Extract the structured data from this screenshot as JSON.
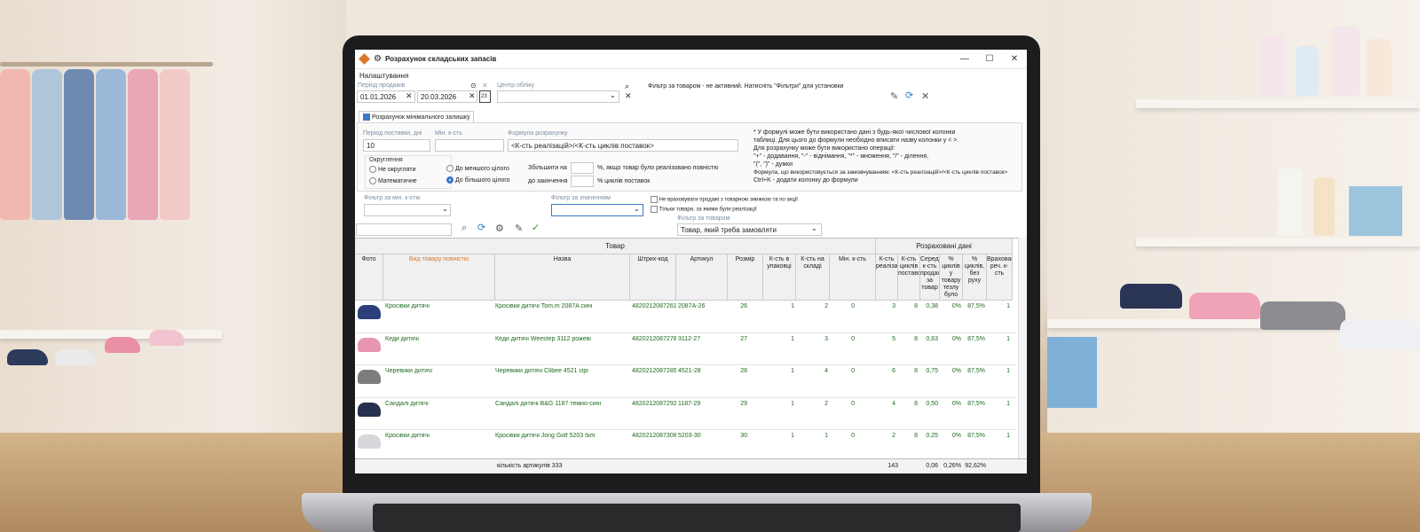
{
  "window": {
    "title": "Розрахунок складських запасів",
    "icon": "app-logo-icon",
    "controls": [
      "—",
      "☐",
      "✕"
    ]
  },
  "menu": {
    "settings": "Налаштування"
  },
  "period": {
    "label": "Період продажів",
    "from": "01.01.2026",
    "to": "20.03.2026",
    "calendar_label": "23"
  },
  "accounting_center": {
    "label": "Центр обліку",
    "value": ""
  },
  "product_filter_notice": "Фільтр за товаром - не активний. Натисніть \"Фільтри\" для установки",
  "min_balance_tab": {
    "checkbox_label": "Розрахунок мінімального залишку",
    "checked": true,
    "supply_period_label": "Період поставки, дні",
    "supply_period_value": "10",
    "min_qty_label": "Мін. к-сть",
    "min_qty_value": "",
    "formula_label": "Формула розрахунку",
    "formula_value": "<К-сть реалізацій>/<К-сть циклів поставок>",
    "rounding_label": "Округлення",
    "rounding_options": [
      "Не округляти",
      "Математичне",
      "До меншого цілого",
      "До більшого цілого"
    ],
    "rounding_selected": "До більшого цілого",
    "increase_label": "Збільшити на",
    "increase_suffix": "%, якщо товар було реалізовано повністю",
    "until_end_label": "до закінчення",
    "until_end_suffix": "% циклів поставок",
    "help_lines": [
      "* У формулі може бути використано дані з будь-якої числової колонки",
      "таблиці. Для цього до формули необхідно вписати назву колонки у < >.",
      "Для розрахунку може бути використано операції:",
      "\"+\" - додавання, \"-\" - віднімання, \"*\" - множення, \"/\" - ділення,",
      "\"(\", \")\" - дужки",
      "Формула, що використовується за замовчуванням: <К-сть реалізацій>/<К-сть циклів поставок>",
      "Ctrl+K - додати колонку до формули"
    ]
  },
  "filters": {
    "min_qty_filter_label": "Фільтр за мін. к-стю",
    "value_filter_label": "Фільтр за значенням",
    "exclude_promo_label": "Не враховувати продажі з товарною знижкою та по акції",
    "only_sold_label": "Тільки товари, за якими були реалізації",
    "product_filter_label": "Фільтр за товаром",
    "product_filter_value": "Товар, який треба замовляти"
  },
  "table": {
    "group_headers": {
      "product": "Товар",
      "calculated": "Розраховані дані"
    },
    "columns": [
      "Фото",
      "Вид товару повністю",
      "Назва",
      "Штрих-код",
      "Артикул",
      "Розмір",
      "К-сть в упаковці",
      "К-сть на складі",
      "Мін. к-сть",
      "К-сть реалізацій",
      "К-сть циклів поставок",
      "Середня к-сть продажу за товар",
      "% циклів у товару тезлу було",
      "% циклів, без руху",
      "Враховано реч. к-сть"
    ],
    "rows": [
      {
        "color": "#2b3f7a",
        "type": "Кросівки дитячі",
        "name": "Кросівки дитячі Tom.m 2087A сині",
        "barcode": "4820212087261",
        "article": "2087A-26",
        "size": "26",
        "pack": "1",
        "stock": "2",
        "min": "0",
        "sales": "3",
        "cycles": "8",
        "avg": "0,38",
        "pct": "0%",
        "pct2": "87,5%",
        "acc": "1"
      },
      {
        "color": "#e895b0",
        "type": "Кеди дитячі",
        "name": "Кеди дитячі Weestep 3112 рожеві",
        "barcode": "4820212087278",
        "article": "3112-27",
        "size": "27",
        "pack": "1",
        "stock": "3",
        "min": "0",
        "sales": "5",
        "cycles": "8",
        "avg": "0,63",
        "pct": "0%",
        "pct2": "87,5%",
        "acc": "1"
      },
      {
        "color": "#7d7d80",
        "type": "Черевики дитячі",
        "name": "Черевики дитячі Clibee 4521 сірі",
        "barcode": "4820212087285",
        "article": "4521-28",
        "size": "28",
        "pack": "1",
        "stock": "4",
        "min": "0",
        "sales": "6",
        "cycles": "8",
        "avg": "0,75",
        "pct": "0%",
        "pct2": "87,5%",
        "acc": "1"
      },
      {
        "color": "#27304d",
        "type": "Сандалі дитячі",
        "name": "Сандалі дитячі B&G 1187 темно-сині",
        "barcode": "4820212087292",
        "article": "1187-29",
        "size": "29",
        "pack": "1",
        "stock": "2",
        "min": "0",
        "sales": "4",
        "cycles": "8",
        "avg": "0,50",
        "pct": "0%",
        "pct2": "87,5%",
        "acc": "1"
      },
      {
        "color": "#d8d8dc",
        "type": "Кросівки дитячі",
        "name": "Кросівки дитячі Jong Golf 5203 білі",
        "barcode": "4820212087308",
        "article": "5203-30",
        "size": "30",
        "pack": "1",
        "stock": "1",
        "min": "0",
        "sales": "2",
        "cycles": "8",
        "avg": "0,25",
        "pct": "0%",
        "pct2": "87,5%",
        "acc": "1"
      }
    ],
    "footer": {
      "articles_count": "кількість артикулів 333",
      "total_sales": "143",
      "avg": "0,06",
      "pct": "0,26%",
      "pct2": "92,62%"
    }
  }
}
